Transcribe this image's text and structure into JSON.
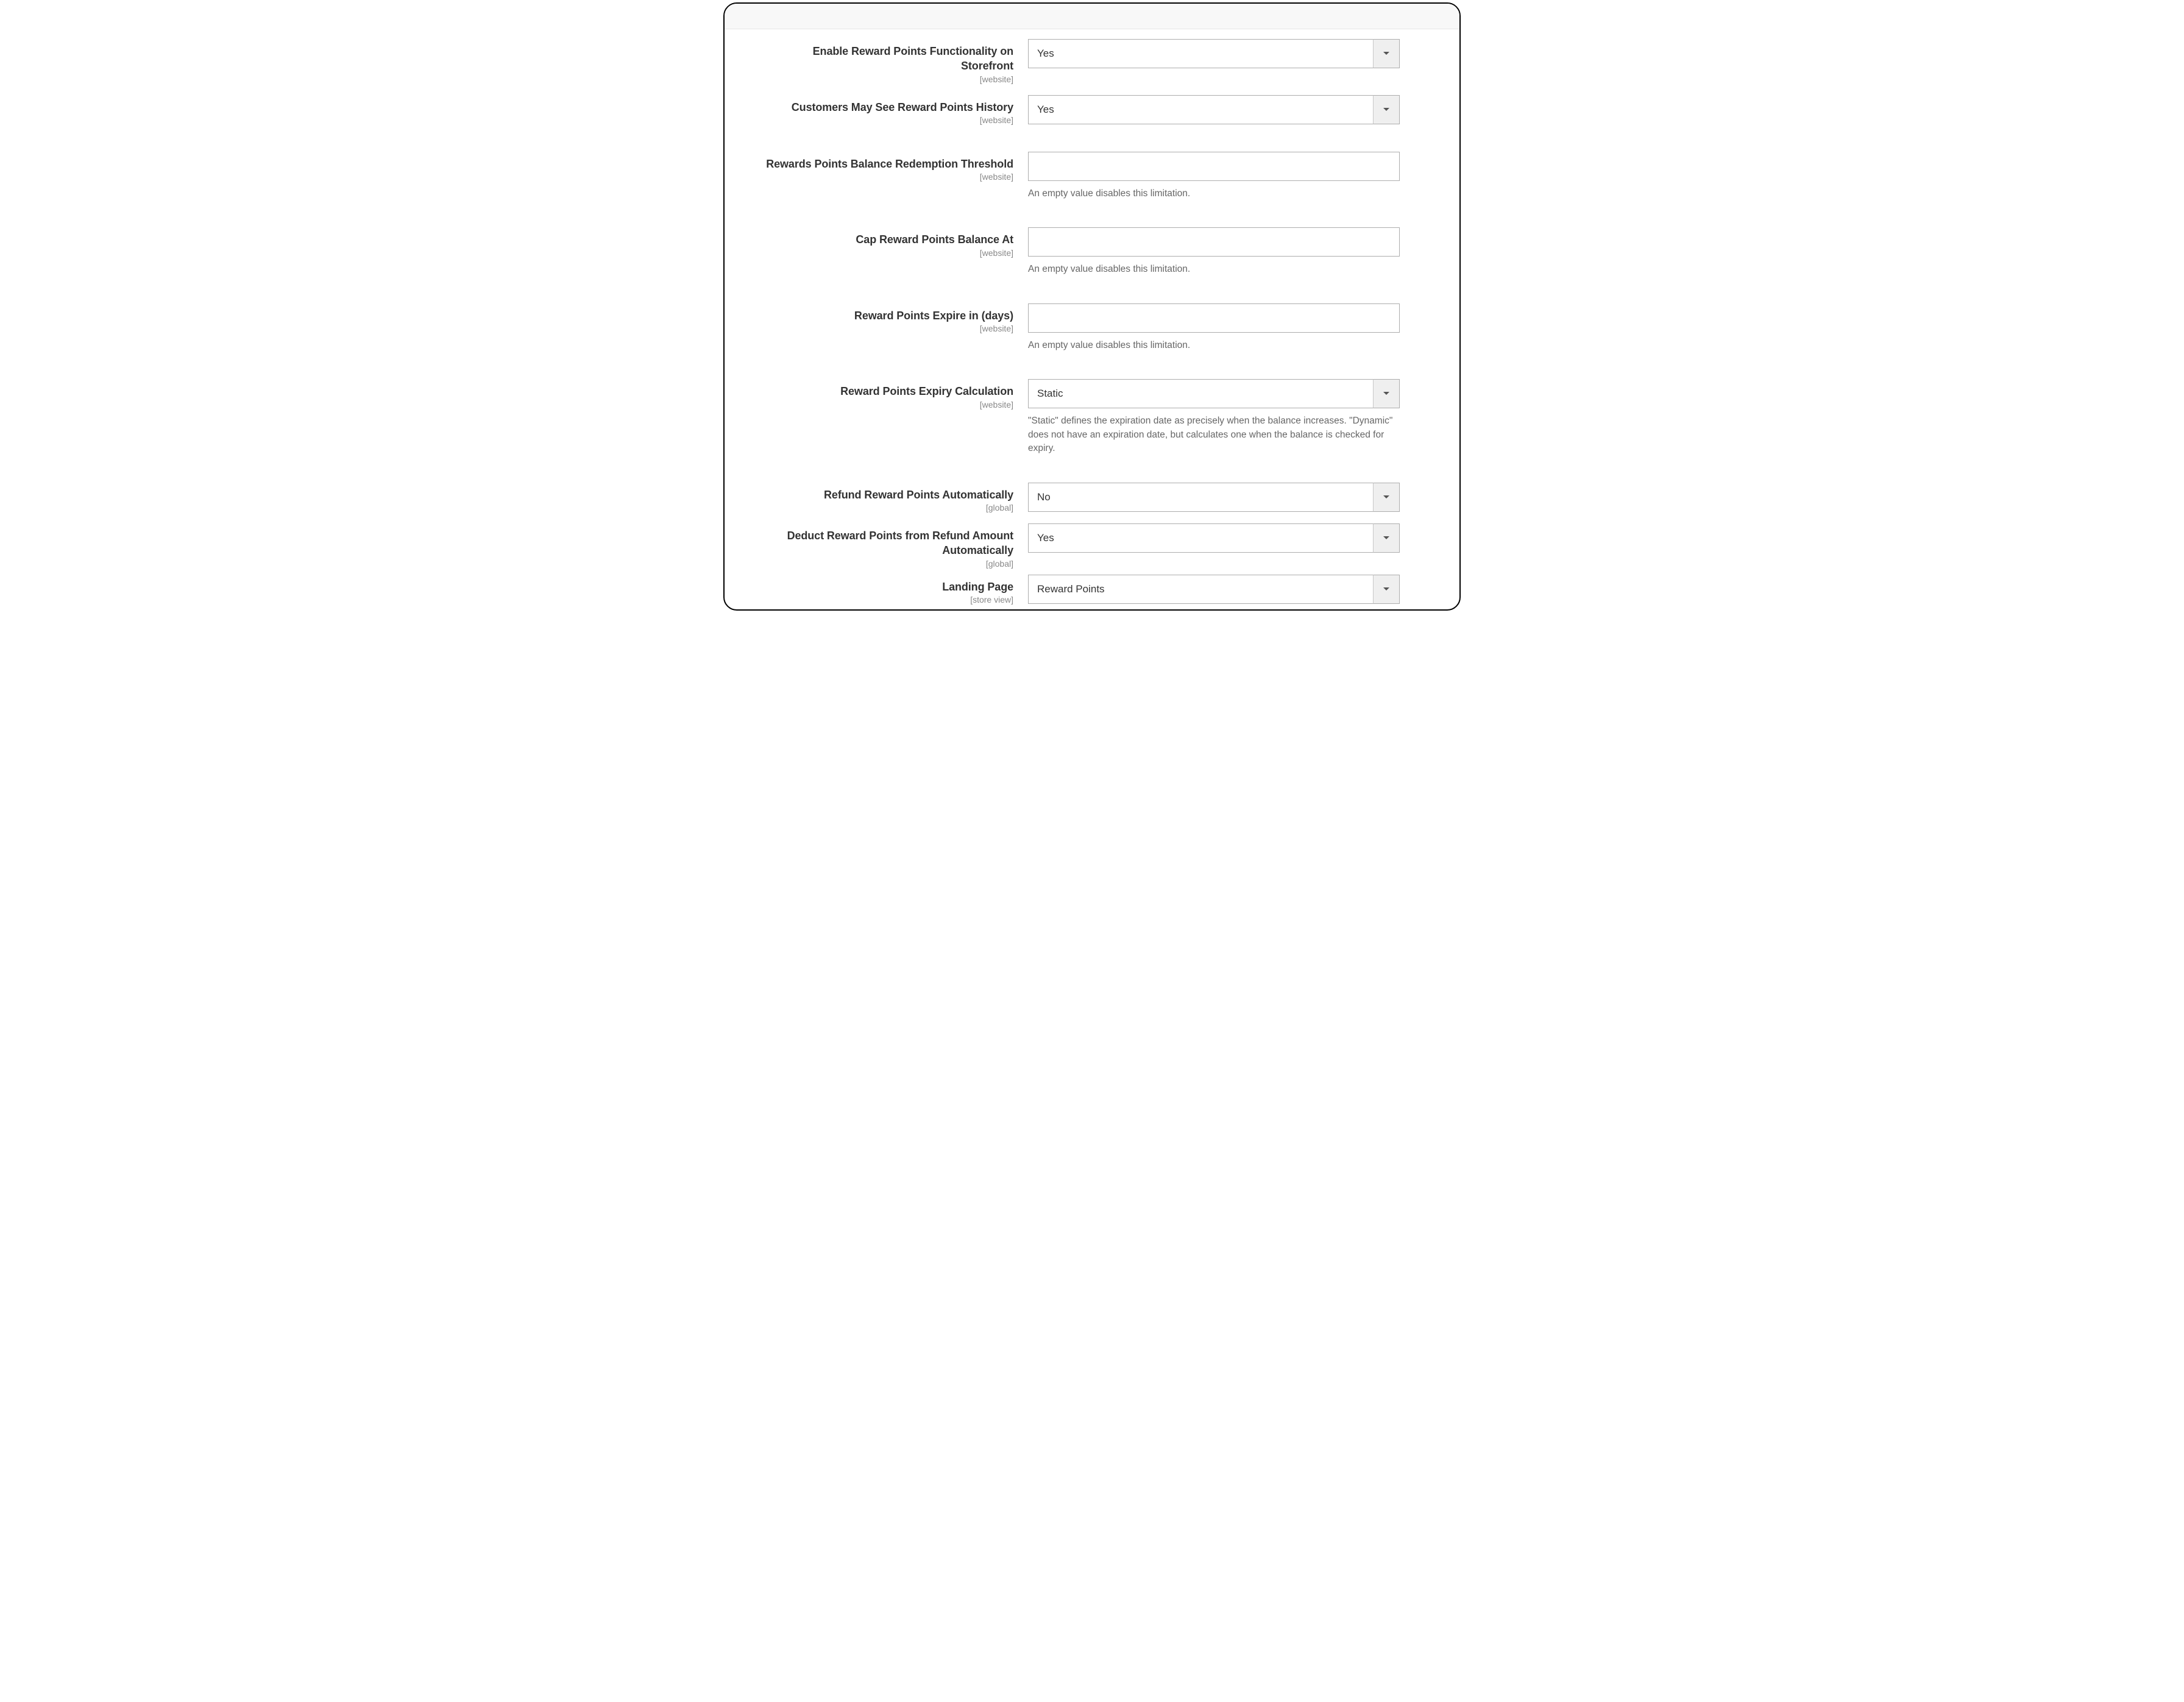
{
  "scopes": {
    "website": "[website]",
    "global": "[global]",
    "store_view": "[store view]"
  },
  "fields": {
    "enable_storefront": {
      "label": "Enable Reward Points Functionality on Storefront",
      "scope_key": "website",
      "value": "Yes"
    },
    "see_history": {
      "label": "Customers May See Reward Points History",
      "scope_key": "website",
      "value": "Yes"
    },
    "redemption_threshold": {
      "label": "Rewards Points Balance Redemption Threshold",
      "scope_key": "website",
      "value": "",
      "help": "An empty value disables this limitation."
    },
    "cap_balance": {
      "label": "Cap Reward Points Balance At",
      "scope_key": "website",
      "value": "",
      "help": "An empty value disables this limitation."
    },
    "expire_days": {
      "label": "Reward Points Expire in (days)",
      "scope_key": "website",
      "value": "",
      "help": "An empty value disables this limitation."
    },
    "expiry_calc": {
      "label": "Reward Points Expiry Calculation",
      "scope_key": "website",
      "value": "Static",
      "help": "\"Static\" defines the expiration date as precisely when the balance increases. \"Dynamic\" does not have an expiration date, but calculates one when the balance is checked for expiry."
    },
    "refund_auto": {
      "label": "Refund Reward Points Automatically",
      "scope_key": "global",
      "value": "No"
    },
    "deduct_refund": {
      "label": "Deduct Reward Points from Refund Amount Automatically",
      "scope_key": "global",
      "value": "Yes"
    },
    "landing_page": {
      "label": "Landing Page",
      "scope_key": "store_view",
      "value": "Reward Points"
    }
  }
}
